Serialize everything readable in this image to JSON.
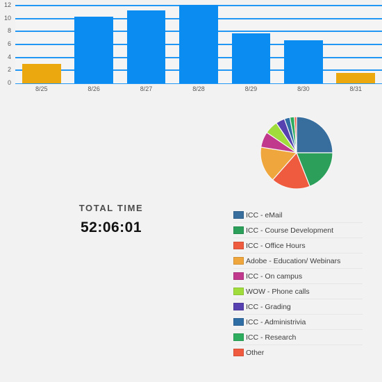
{
  "chart_data": [
    {
      "type": "bar",
      "title": "",
      "xlabel": "",
      "ylabel": "",
      "categories": [
        "8/25",
        "8/26",
        "8/27",
        "8/28",
        "8/29",
        "8/30",
        "8/31"
      ],
      "values": [
        3.0,
        10.3,
        11.2,
        12.1,
        7.7,
        6.6,
        1.6
      ],
      "bar_colors": [
        "#eca90f",
        "#0b8cf0",
        "#0b8cf0",
        "#0b8cf0",
        "#0b8cf0",
        "#0b8cf0",
        "#eca90f"
      ],
      "ylim": [
        0,
        12
      ],
      "yticks": [
        0,
        2,
        4,
        6,
        8,
        10,
        12
      ],
      "ytick_labels": [
        "0",
        "2",
        "4",
        "6",
        "8",
        "10",
        "12"
      ],
      "grid": true,
      "gridline_color": "#2196f3",
      "legend": "none"
    },
    {
      "type": "pie",
      "title": "",
      "labels": [
        "ICC - eMail",
        "ICC - Course Development",
        "ICC - Office Hours",
        "Adobe - Education/ Webinars",
        "ICC - On campus",
        "WOW - Phone calls",
        "ICC - Grading",
        "ICC - Administrivia",
        "ICC - Research",
        "Other"
      ],
      "values": [
        25.0,
        19.0,
        17.5,
        16.0,
        7.0,
        6.0,
        4.0,
        2.5,
        2.0,
        1.0
      ],
      "colors": [
        "#376e9e",
        "#2ca05a",
        "#ef5b3f",
        "#efa63c",
        "#c0398c",
        "#a0dc3c",
        "#5741b0",
        "#2f6ea5",
        "#2fad5e",
        "#f05b40"
      ],
      "legend": "bottom",
      "start_angle": 0
    }
  ],
  "total": {
    "label": "TOTAL TIME",
    "value": "52:06:01"
  },
  "legend": {
    "items": [
      {
        "label": "ICC - eMail",
        "color": "#376e9e"
      },
      {
        "label": "ICC - Course Development",
        "color": "#2ca05a"
      },
      {
        "label": "ICC - Office Hours",
        "color": "#ef5b3f"
      },
      {
        "label": "Adobe - Education/ Webinars",
        "color": "#efa63c"
      },
      {
        "label": "ICC - On campus",
        "color": "#c0398c"
      },
      {
        "label": "WOW - Phone calls",
        "color": "#a0dc3c"
      },
      {
        "label": "ICC - Grading",
        "color": "#5741b0"
      },
      {
        "label": "ICC - Administrivia",
        "color": "#2f6ea5"
      },
      {
        "label": "ICC - Research",
        "color": "#2fad5e"
      },
      {
        "label": "Other",
        "color": "#f05b40"
      }
    ]
  },
  "theme": {
    "background": "#f2f2f2",
    "plot_background": "#f4f4f4",
    "accent_blue": "#0b8cf0",
    "accent_amber": "#eca90f",
    "gridline": "#2196f3",
    "tick_text": "#5a5a5a"
  }
}
